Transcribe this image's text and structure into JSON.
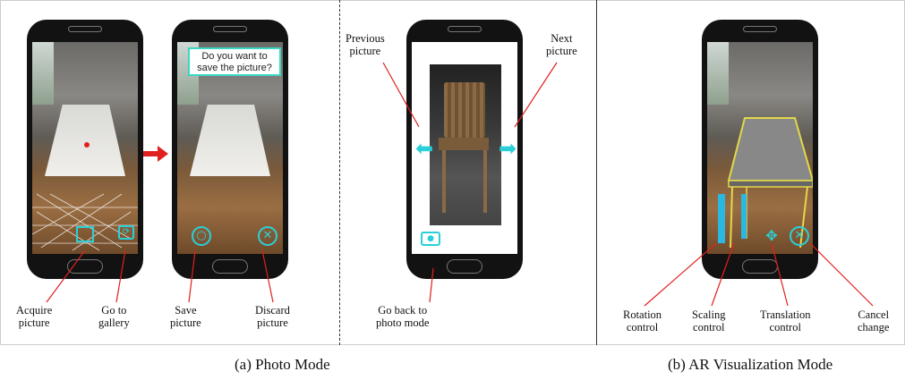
{
  "colors": {
    "accent": "#2ad0d8",
    "arrow": "#e0201f",
    "model": "#e2d84a",
    "bubble_border": "#3bd7c5"
  },
  "photo_mode": {
    "caption": "(a) Photo Mode",
    "labels": {
      "acquire": "Acquire\npicture",
      "gallery": "Go to\ngallery",
      "save": "Save\npicture",
      "discard": "Discard\npicture",
      "previous": "Previous\npicture",
      "next": "Next\npicture",
      "back": "Go back to\nphoto mode"
    },
    "dialog": "Do you want to\nsave the picture?",
    "icons": {
      "acquire": "square-target-icon",
      "gallery": "gallery-icon",
      "save": "save-circle-icon",
      "discard": "discard-x-icon",
      "previous": "previous-arrow-icon",
      "next": "next-arrow-icon",
      "back": "camera-icon"
    }
  },
  "ar_mode": {
    "caption": "(b) AR Visualization Mode",
    "labels": {
      "rotation": "Rotation\ncontrol",
      "scaling": "Scaling\ncontrol",
      "translation": "Translation\ncontrol",
      "cancel": "Cancel\nchange"
    },
    "icons": {
      "rotation": "rotation-arrow-icon",
      "scaling": "scaling-arrow-icon",
      "translation": "move-icon",
      "cancel": "cancel-x-icon"
    }
  }
}
